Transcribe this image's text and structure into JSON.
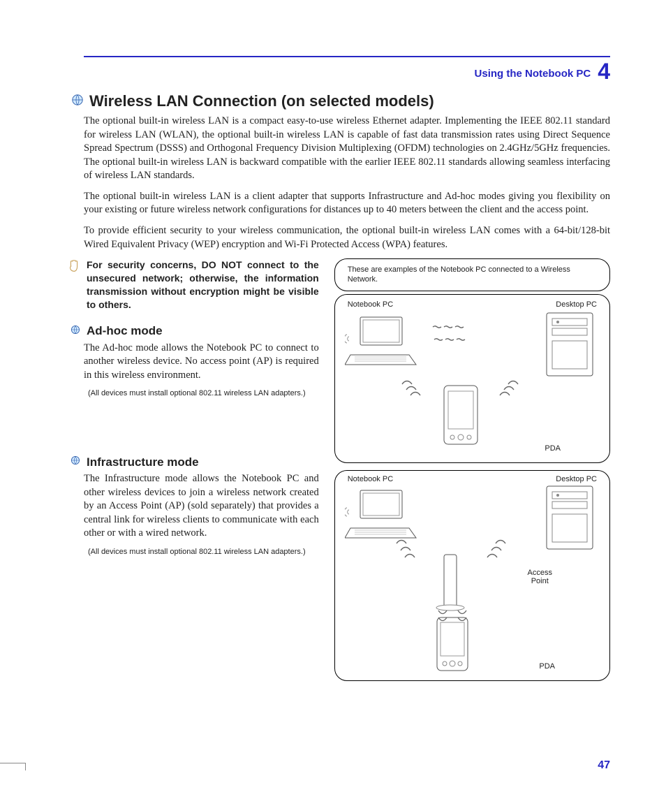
{
  "header": {
    "section_title": "Using the Notebook PC",
    "chapter_number": "4"
  },
  "title": "Wireless LAN Connection (on selected models)",
  "paragraphs": {
    "p1": "The optional built-in wireless LAN is a compact easy-to-use wireless Ethernet adapter. Implementing the IEEE 802.11 standard for wireless LAN (WLAN), the optional built-in wireless LAN is capable of fast data transmission rates using Direct Sequence Spread Spectrum (DSSS) and Orthogonal Frequency Division Multiplexing (OFDM) technologies on 2.4GHz/5GHz frequencies. The optional built-in wireless LAN is backward compatible with the earlier IEEE 802.11 standards allowing seamless interfacing of wireless LAN standards.",
    "p2": "The optional built-in wireless LAN is a client adapter that supports Infrastructure and Ad-hoc modes giving you flexibility on your existing or future wireless network configurations for distances up to 40 meters between the client and the access point.",
    "p3": "To provide efficient security to your wireless communication, the optional built-in wireless LAN comes with a 64-bit/128-bit Wired Equivalent Privacy (WEP) encryption and Wi-Fi Protected Access (WPA) features."
  },
  "warning": "For security concerns, DO NOT connect to the unsecured network; otherwise, the information transmission without encryption might be visible to others.",
  "adhoc": {
    "title": "Ad-hoc mode",
    "body": "The Ad-hoc mode allows the Notebook PC to connect to another wireless device. No access point (AP) is required in this wireless environment.",
    "note": "(All devices must install optional 802.11 wireless LAN adapters.)"
  },
  "infra": {
    "title": "Infrastructure mode",
    "body": "The Infrastructure mode allows the Notebook PC and other wireless devices to join a wireless network created by an Access Point (AP) (sold separately) that provides a central link for wireless clients to communicate with each other or with a wired network.",
    "note": "(All devices must install optional 802.11 wireless LAN adapters.)"
  },
  "diagram": {
    "example_caption": "These are examples of the Notebook PC connected to a Wireless Network.",
    "labels": {
      "notebook": "Notebook PC",
      "desktop": "Desktop PC",
      "pda": "PDA",
      "access_point": "Access\nPoint"
    }
  },
  "page_number": "47"
}
